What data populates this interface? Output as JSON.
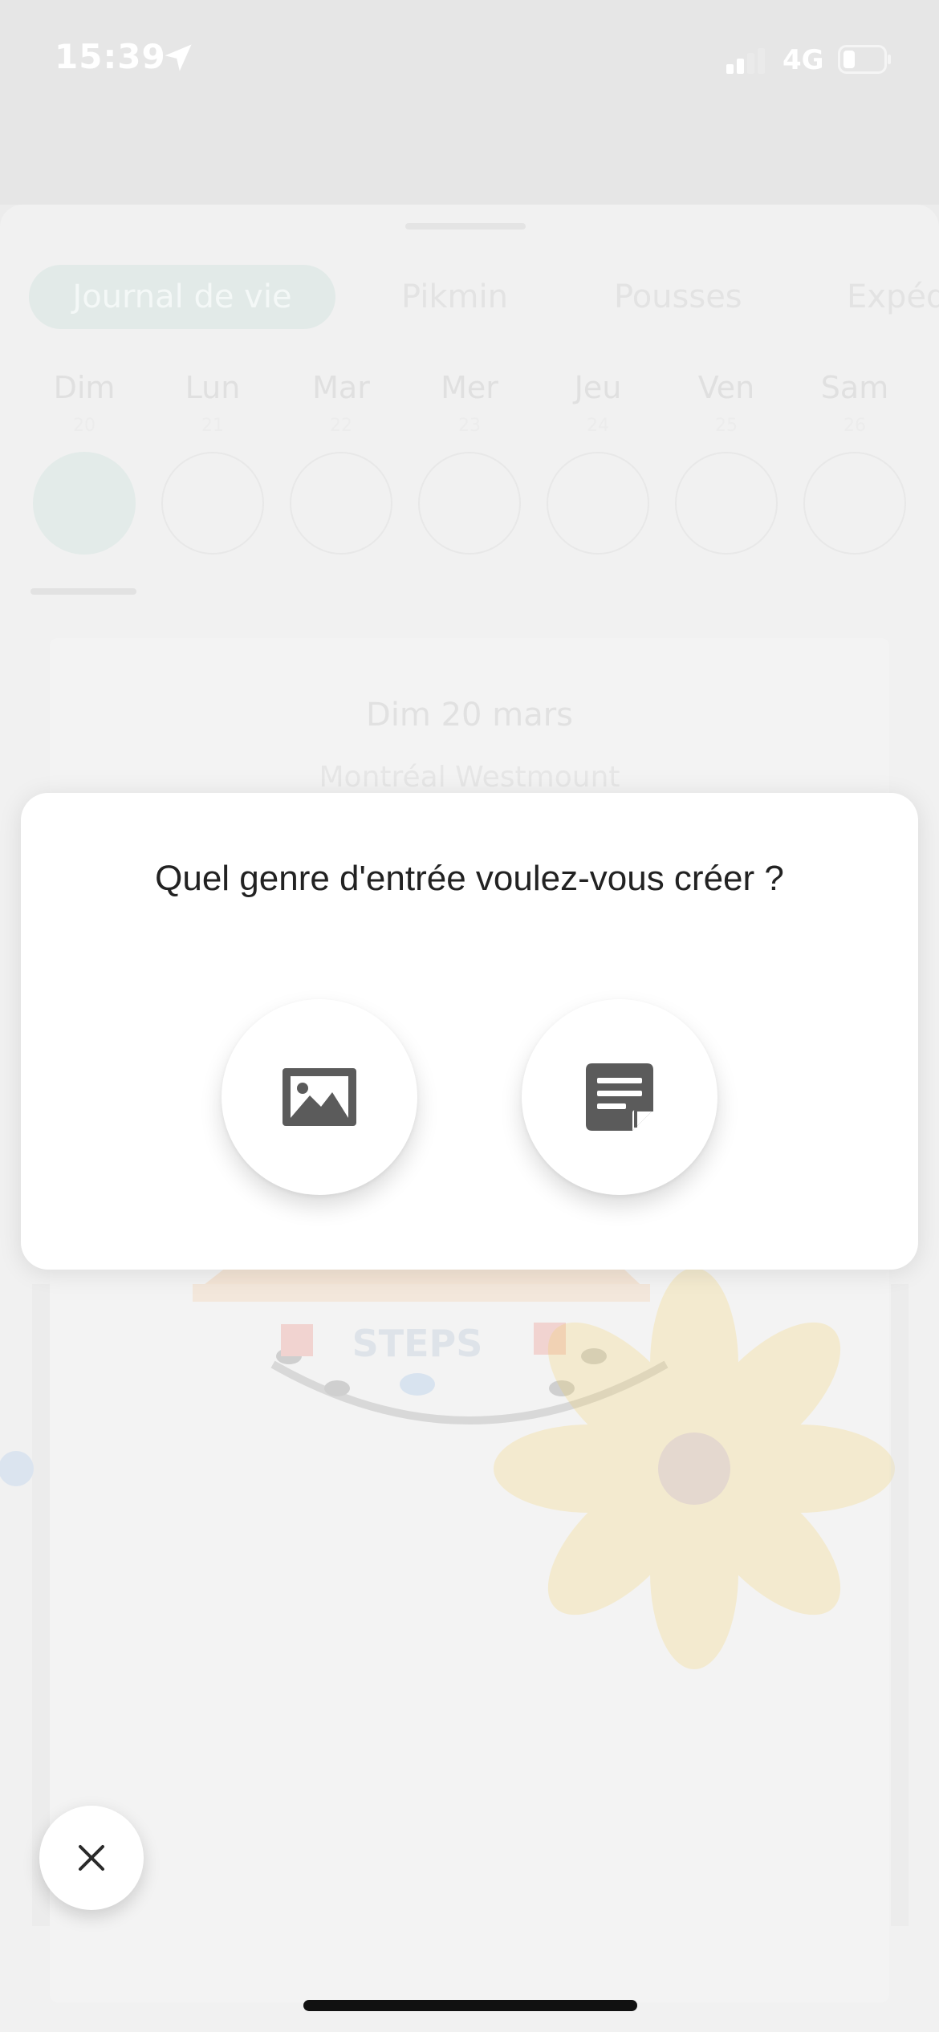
{
  "status_bar": {
    "time": "15:39",
    "network": "4G",
    "icons": [
      "location-arrow-icon",
      "signal-icon",
      "battery-icon"
    ]
  },
  "background": {
    "tabs": [
      "Journal de vie",
      "Pikmin",
      "Pousses",
      "Expéd"
    ],
    "days": [
      {
        "name": "Dim",
        "num": "20"
      },
      {
        "name": "Lun",
        "num": "21"
      },
      {
        "name": "Mar",
        "num": "22"
      },
      {
        "name": "Mer",
        "num": "23"
      },
      {
        "name": "Jeu",
        "num": "24"
      },
      {
        "name": "Ven",
        "num": "25"
      },
      {
        "name": "Sam",
        "num": "26"
      }
    ],
    "card_date": "Dim 20 mars",
    "card_location": "Montréal Westmount",
    "badge_text": "STEPS"
  },
  "modal": {
    "title": "Quel genre d'entrée voulez-vous créer ?",
    "options": [
      {
        "icon": "image-icon"
      },
      {
        "icon": "note-icon"
      }
    ]
  },
  "close_button": {
    "icon": "close-icon"
  },
  "colors": {
    "accent_pale": "#e2eae8",
    "icon_gray": "#5b5b5b",
    "background": "#ececec"
  }
}
